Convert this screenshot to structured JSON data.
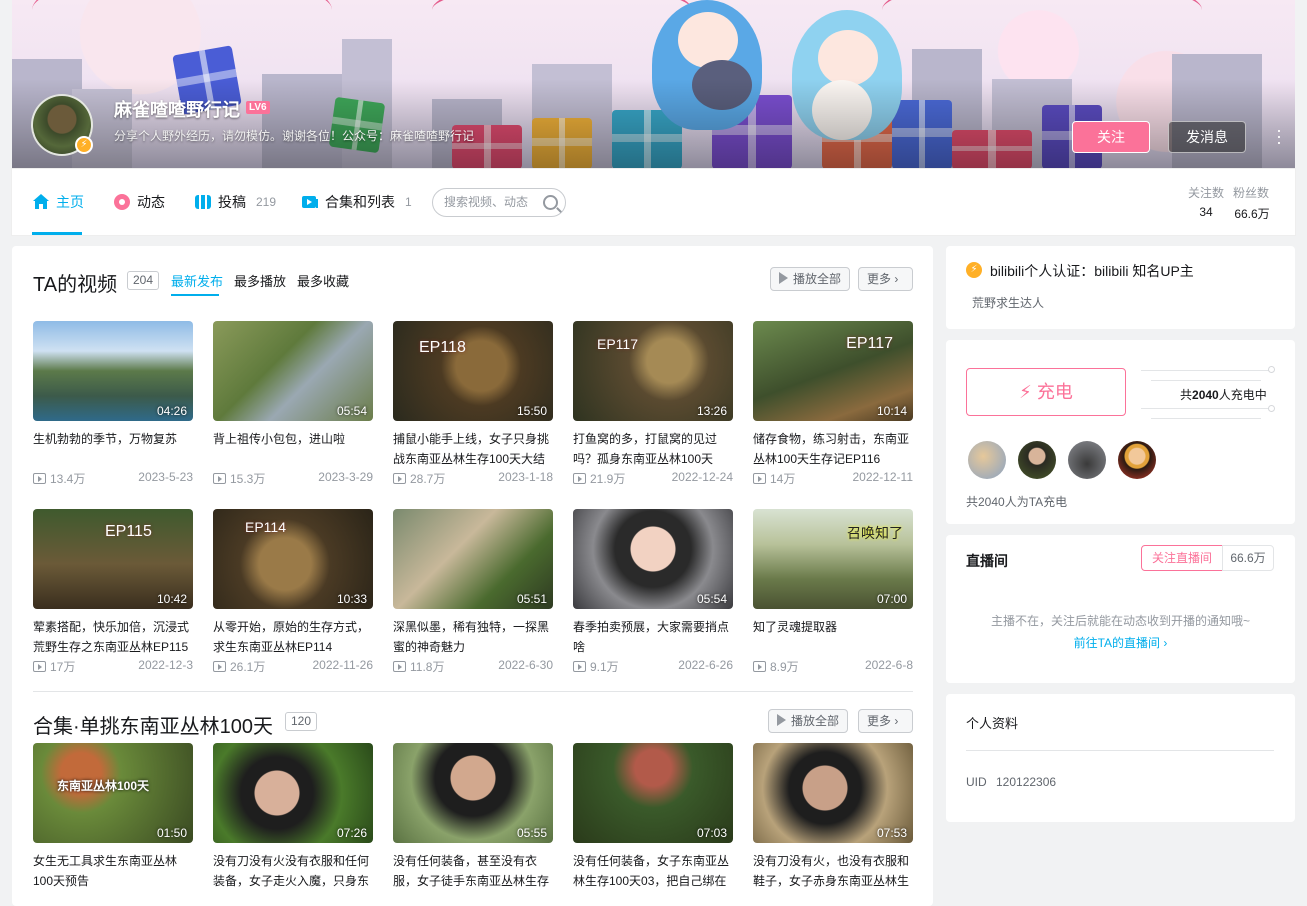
{
  "profile": {
    "name": "麻雀喳喳野行记",
    "level": "LV6",
    "sign": "分享个人野外经历，请勿模仿。谢谢各位！公众号：麻雀喳喳野行记",
    "follow_label": "关注",
    "message_label": "发消息"
  },
  "nav": {
    "home": "主页",
    "dynamic": "动态",
    "posts": "投稿",
    "posts_count": "219",
    "collections": "合集和列表",
    "collections_count": "1",
    "search_placeholder": "搜索视频、动态",
    "following_label": "关注数",
    "following_value": "34",
    "fans_label": "粉丝数",
    "fans_value": "66.6万"
  },
  "videos_section": {
    "title": "TA的视频",
    "count": "204",
    "tabs": [
      "最新发布",
      "最多播放",
      "最多收藏"
    ],
    "play_all": "播放全部",
    "more": "更多",
    "items": [
      {
        "title": "生机勃勃的季节，万物复苏",
        "duration": "04:26",
        "plays": "13.4万",
        "date": "2023-5-23"
      },
      {
        "title": "背上祖传小包包，进山啦",
        "duration": "05:54",
        "plays": "15.3万",
        "date": "2023-3-29"
      },
      {
        "title": "捕鼠小能手上线，女子只身挑战东南亚丛林生存100天大结局",
        "duration": "15:50",
        "plays": "28.7万",
        "date": "2023-1-18",
        "badge": "EP118"
      },
      {
        "title": "打鱼窝的多，打鼠窝的见过吗？孤身东南亚丛林100天",
        "duration": "13:26",
        "plays": "21.9万",
        "date": "2022-12-24",
        "badge": "EP117"
      },
      {
        "title": "储存食物，练习射击，东南亚丛林100天生存记EP116",
        "duration": "10:14",
        "plays": "14万",
        "date": "2022-12-11",
        "badge": "EP117"
      },
      {
        "title": "荤素搭配，快乐加倍，沉浸式荒野生存之东南亚丛林EP115",
        "duration": "10:42",
        "plays": "17万",
        "date": "2022-12-3",
        "badge": "EP115"
      },
      {
        "title": "从零开始，原始的生存方式，求生东南亚丛林EP114",
        "duration": "10:33",
        "plays": "26.1万",
        "date": "2022-11-26",
        "badge": "EP114"
      },
      {
        "title": "深黑似墨，稀有独特，一探黑蜜的神奇魅力",
        "duration": "05:51",
        "plays": "11.8万",
        "date": "2022-6-30"
      },
      {
        "title": "春季拍卖预展，大家需要捎点啥",
        "duration": "05:54",
        "plays": "9.1万",
        "date": "2022-6-26"
      },
      {
        "title": "知了灵魂提取器",
        "duration": "07:00",
        "plays": "8.9万",
        "date": "2022-6-8",
        "badge": "召唤知了"
      }
    ]
  },
  "collection_section": {
    "title": "合集·单挑东南亚丛林100天",
    "count": "120",
    "play_all": "播放全部",
    "more": "更多",
    "items": [
      {
        "title": "女生无工具求生东南亚丛林100天预告",
        "duration": "01:50",
        "badge": "东南亚丛林100天"
      },
      {
        "title": "没有刀没有火没有衣服和任何装备，女子走火入魔，只身东",
        "duration": "07:26"
      },
      {
        "title": "没有任何装备，甚至没有衣服，女子徒手东南亚丛林生存",
        "duration": "05:55"
      },
      {
        "title": "没有任何装备，女子东南亚丛林生存100天03，把自己绑在",
        "duration": "07:03"
      },
      {
        "title": "没有刀没有火，也没有衣服和鞋子，女子赤身东南亚丛林生",
        "duration": "07:53"
      }
    ]
  },
  "sidebar": {
    "verify": "bilibili个人认证：bilibili 知名UP主",
    "verify_sub": "荒野求生达人",
    "charge_label": "充电",
    "charge_count_prefix": "共",
    "charge_count_num": "2040",
    "charge_count_suffix": "人充电中",
    "charge_total": "共2040人为TA充电",
    "live_title": "直播间",
    "live_follow": "关注直播间",
    "live_fans": "66.6万",
    "live_tip": "主播不在，关注后就能在动态收到开播的通知哦~",
    "live_link": "前往TA的直播间",
    "profile_title": "个人资料",
    "uid_label": "UID",
    "uid_value": "120122306"
  },
  "colors": {
    "accent": "#00aeec",
    "pink": "#fb7299",
    "gold": "#ffb027"
  }
}
